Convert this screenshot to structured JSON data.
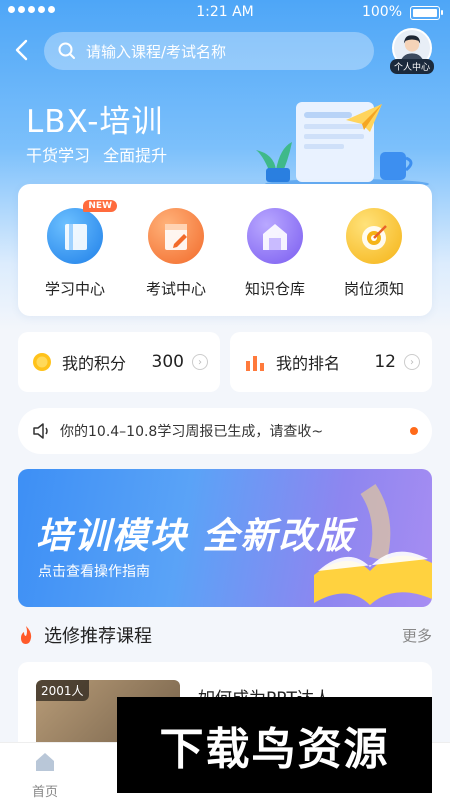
{
  "status_bar": {
    "time": "1:21 AM",
    "battery": "100%"
  },
  "search": {
    "placeholder": "请输入课程/考试名称"
  },
  "profile": {
    "label": "个人中心"
  },
  "hero": {
    "title": "LBX-培训",
    "subtitle": "干货学习  全面提升"
  },
  "quick_links": [
    {
      "label": "学习中心",
      "badge": "NEW"
    },
    {
      "label": "考试中心"
    },
    {
      "label": "知识仓库"
    },
    {
      "label": "岗位须知"
    }
  ],
  "stats": {
    "points": {
      "label": "我的积分",
      "value": "300"
    },
    "rank": {
      "label": "我的排名",
      "value": "12"
    }
  },
  "notice": {
    "text": "你的10.4–10.8学习周报已生成，请查收~"
  },
  "banner": {
    "title": "培训模块 全新改版",
    "subtitle": "点击查看操作指南"
  },
  "section": {
    "title": "选修推荐课程",
    "more": "更多"
  },
  "course": {
    "count": "2001人",
    "title": "如何成为PPT达人"
  },
  "tabs": [
    {
      "label": "首页"
    }
  ],
  "watermark": {
    "text": "下载鸟资源"
  },
  "colors": {
    "primary": "#4ea6f7",
    "accent": "#ff6a1a"
  }
}
